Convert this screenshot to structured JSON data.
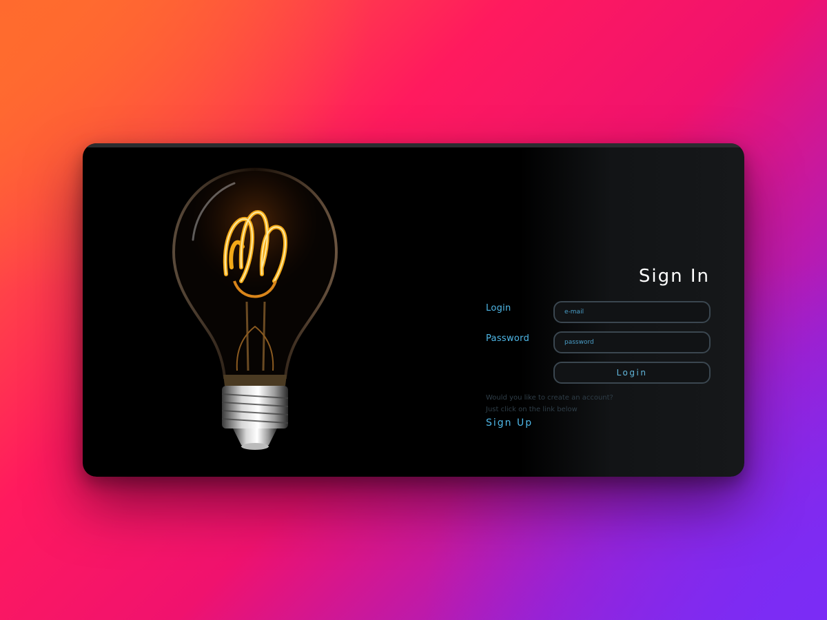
{
  "card": {
    "title": "Sign In",
    "form": {
      "login_label": "Login",
      "password_label": "Password",
      "email_placeholder": "e-mail",
      "password_placeholder": "password",
      "login_button": "Login"
    },
    "signup": {
      "prompt_line1": "Would you like to create an account?",
      "prompt_line2": "Just click on the link below",
      "link_label": "Sign Up"
    },
    "illustration": "light-bulb-icon"
  },
  "colors": {
    "accent": "#4fb8e8",
    "card_bg": "#000000",
    "panel_bg": "#16181a",
    "input_border": "#3b4750",
    "filament": "#ffb21a"
  }
}
